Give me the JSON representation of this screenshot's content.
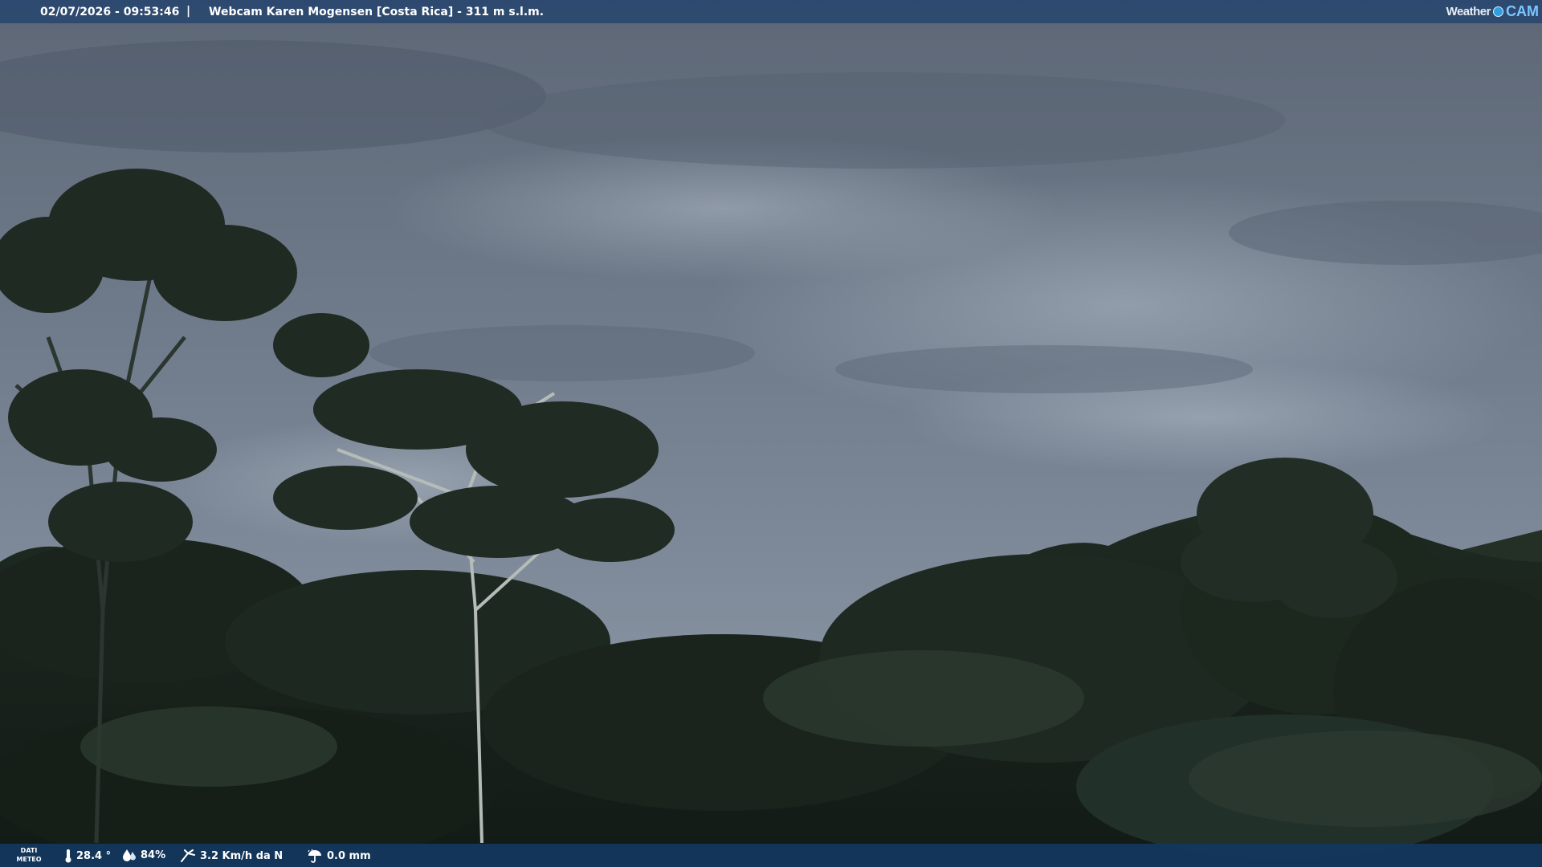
{
  "header": {
    "timestamp": "02/07/2026 - 09:53:46",
    "separator": "|",
    "title": "Webcam Karen Mogensen [Costa Rica]  - 311 m s.l.m.",
    "brand": {
      "left": "Weather",
      "right": "CAM"
    }
  },
  "meteo": {
    "label_line1": "DATI",
    "label_line2": "METEO",
    "temperature": "28.4 °",
    "humidity": "84%",
    "wind": "3.2 Km/h da N",
    "rain": "0.0 mm"
  },
  "icons": [
    "thermometer-icon",
    "humidity-drop-icon",
    "wind-icon",
    "rain-umbrella-icon"
  ],
  "colors": {
    "bar_top": "#28466e",
    "bar_bottom": "#14375f",
    "text": "#ffffff",
    "brand_accent": "#7cc6ff"
  }
}
